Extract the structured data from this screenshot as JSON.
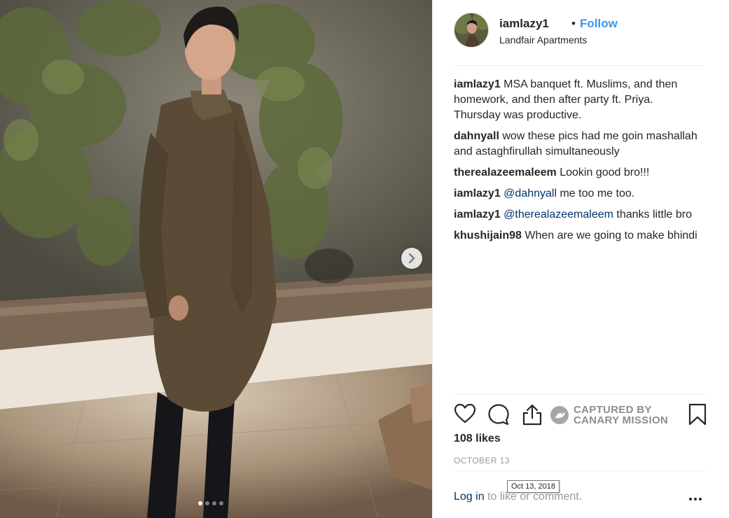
{
  "header": {
    "username": "iamlazy1",
    "bullet": "•",
    "follow_label": "Follow",
    "location": "Landfair Apartments"
  },
  "comments": [
    {
      "user": "iamlazy1",
      "text": " MSA banquet ft. Muslims, and then homework, and then after party ft. Priya. Thursday was productive."
    },
    {
      "user": "dahnyall",
      "text": " wow these pics had me goin mashallah and astaghfirullah simultaneously"
    },
    {
      "user": "therealazeemaleem",
      "text": " Lookin good bro!!!"
    },
    {
      "user": "iamlazy1",
      "mention": "@dahnyall",
      "text": " me too me too."
    },
    {
      "user": "iamlazy1",
      "mention": "@therealazeemaleem",
      "text": " thanks little bro"
    },
    {
      "user": "khushijain98",
      "text": " When are we going to make bhindi"
    }
  ],
  "watermark": {
    "line1": "CAPTURED BY",
    "line2": "CANARY MISSION"
  },
  "likes": "108 likes",
  "date": "OCTOBER 13",
  "tooltip": "Oct 13, 2018",
  "footer": {
    "login_link": "Log in",
    "login_rest": " to like or comment."
  },
  "carousel": {
    "total_slides": 4,
    "active_index": 0
  },
  "icons": {
    "heart": "heart-icon",
    "comment": "comment-bubble-icon",
    "share": "share-icon",
    "save": "bookmark-icon",
    "more": "more-options-icon",
    "next": "chevron-right-icon"
  },
  "colors": {
    "link_blue": "#3897f0",
    "mention_navy": "#003569",
    "muted_gray": "#999999"
  }
}
